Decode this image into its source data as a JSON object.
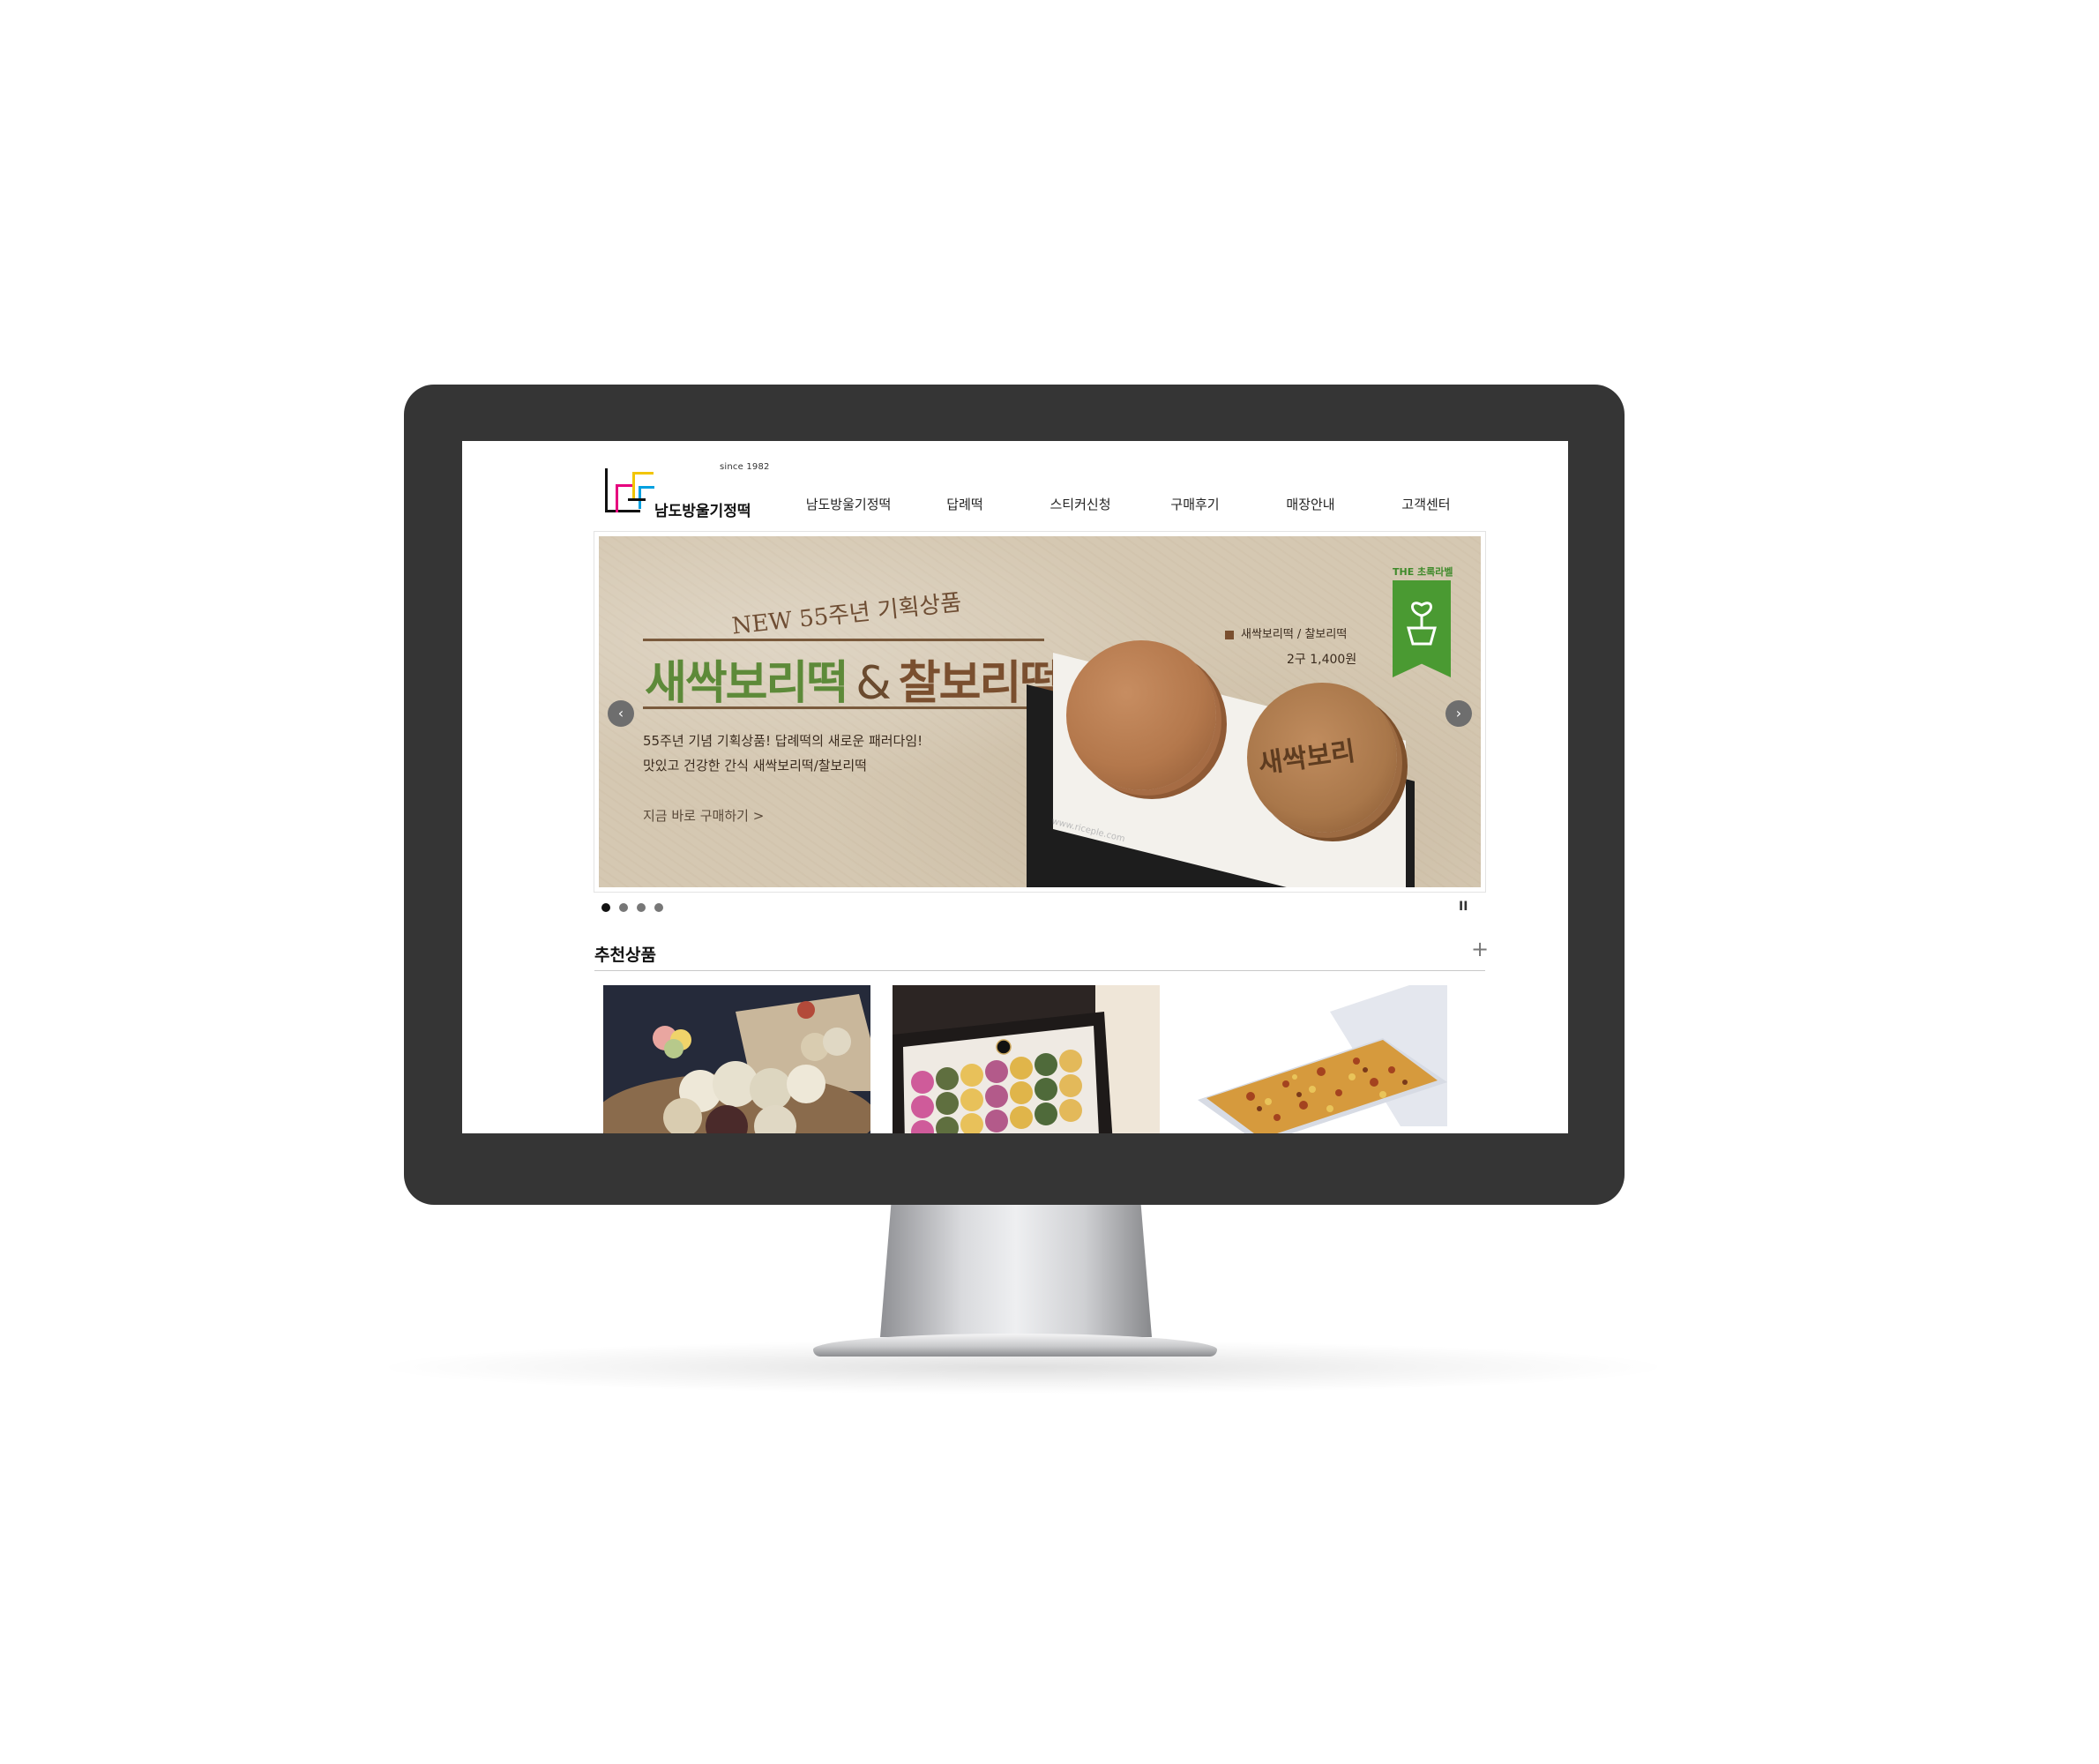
{
  "site": {
    "since": "since 1982",
    "logo_text": "남도방울기정떡"
  },
  "nav": {
    "items": [
      {
        "label": "남도방울기정떡"
      },
      {
        "label": "답례떡"
      },
      {
        "label": "스티커신청"
      },
      {
        "label": "구매후기"
      },
      {
        "label": "매장안내"
      },
      {
        "label": "고객센터"
      }
    ]
  },
  "banner": {
    "headline_small": "NEW 55주년 기획상품",
    "title_part1": "새싹보리떡",
    "title_amp": "&",
    "title_part2": "찰보리떡",
    "desc_line1": "55주년 기념 기획상품! 답례떡의 새로운 패러다임!",
    "desc_line2": "맛있고 건강한 간식 새싹보리떡/찰보리떡",
    "cta": "지금 바로 구매하기 >",
    "product_name": "새싹보리떡 / 찰보리떡",
    "product_price": "2구 1,400원",
    "badge_text": "THE 초록라벨",
    "stamp_text": "새싹보리",
    "box_text": "www.riceple.com",
    "prev_arrow": "‹",
    "next_arrow": "›",
    "pause_symbol": "II",
    "slides": 4,
    "active_slide": 1
  },
  "recommended": {
    "title": "추천상품",
    "more_symbol": "+"
  },
  "colors": {
    "bezel": "#353535",
    "banner_bg": "#d5c8b2",
    "brand_green": "#5d8a39",
    "brand_brown": "#7a4f2f"
  }
}
